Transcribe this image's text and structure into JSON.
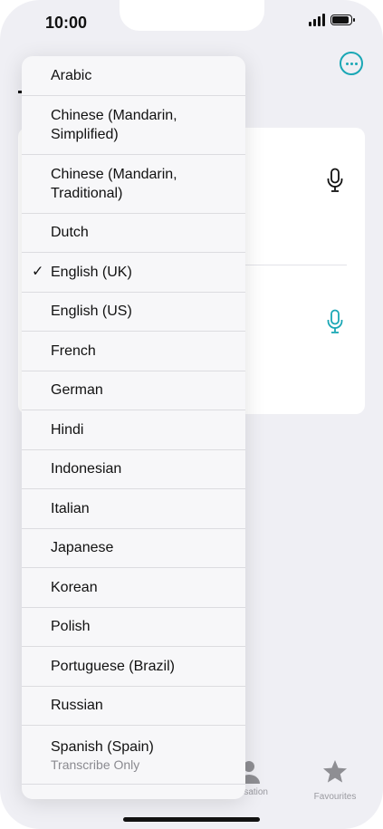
{
  "status_bar": {
    "time": "10:00"
  },
  "languages": [
    {
      "label": "Arabic",
      "tall": false,
      "checked": false,
      "sub": ""
    },
    {
      "label": "Chinese (Mandarin, Simplified)",
      "tall": true,
      "checked": false,
      "sub": ""
    },
    {
      "label": "Chinese (Mandarin, Traditional)",
      "tall": true,
      "checked": false,
      "sub": ""
    },
    {
      "label": "Dutch",
      "tall": false,
      "checked": false,
      "sub": ""
    },
    {
      "label": "English (UK)",
      "tall": false,
      "checked": true,
      "sub": ""
    },
    {
      "label": "English (US)",
      "tall": false,
      "checked": false,
      "sub": ""
    },
    {
      "label": "French",
      "tall": false,
      "checked": false,
      "sub": ""
    },
    {
      "label": "German",
      "tall": false,
      "checked": false,
      "sub": ""
    },
    {
      "label": "Hindi",
      "tall": false,
      "checked": false,
      "sub": ""
    },
    {
      "label": "Indonesian",
      "tall": false,
      "checked": false,
      "sub": ""
    },
    {
      "label": "Italian",
      "tall": false,
      "checked": false,
      "sub": ""
    },
    {
      "label": "Japanese",
      "tall": false,
      "checked": false,
      "sub": ""
    },
    {
      "label": "Korean",
      "tall": false,
      "checked": false,
      "sub": ""
    },
    {
      "label": "Polish",
      "tall": false,
      "checked": false,
      "sub": ""
    },
    {
      "label": "Portuguese (Brazil)",
      "tall": false,
      "checked": false,
      "sub": ""
    },
    {
      "label": "Russian",
      "tall": false,
      "checked": false,
      "sub": ""
    },
    {
      "label": "Spanish (Spain)",
      "tall": true,
      "checked": false,
      "sub": "Transcribe Only"
    }
  ],
  "check_glyph": "✓",
  "tabbar": {
    "conversation_partial": "sation",
    "favourites": "Favourites"
  },
  "colors": {
    "accent": "#1aa7b5",
    "background": "#efeff4"
  }
}
